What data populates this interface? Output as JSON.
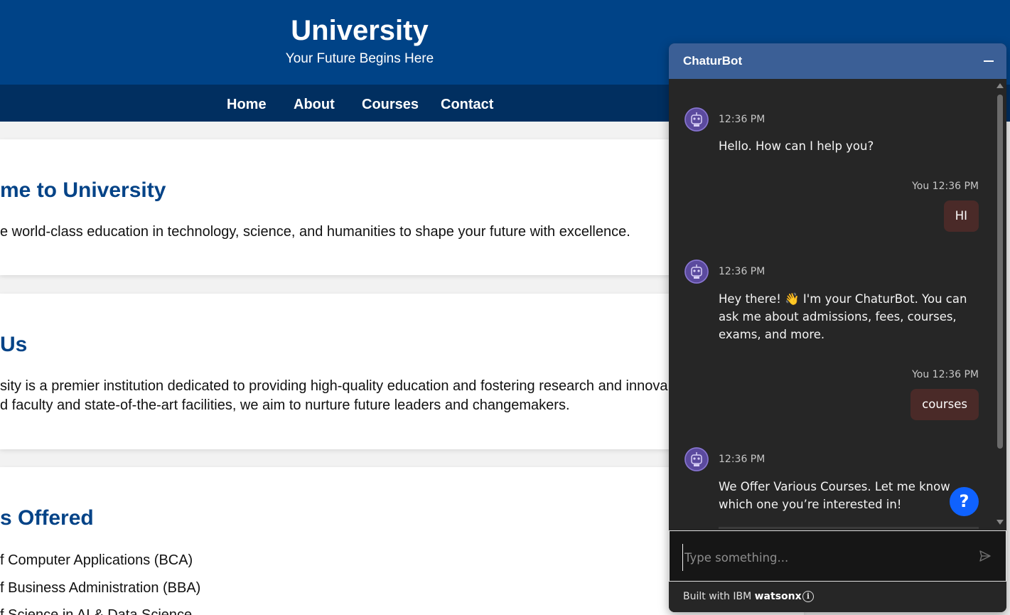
{
  "site": {
    "title": "University",
    "tagline": "Your Future Begins Here"
  },
  "nav": {
    "items": [
      "Home",
      "About",
      "Courses",
      "Contact"
    ]
  },
  "welcome": {
    "heading": "me to University",
    "text": "e world-class education in technology, science, and humanities to shape your future with excellence."
  },
  "about": {
    "heading": "Us",
    "line1": "sity is a premier institution dedicated to providing high-quality education and fostering research and innova",
    "line2": "d faculty and state-of-the-art facilities, we aim to nurture future leaders and changemakers."
  },
  "courses": {
    "heading": "s Offered",
    "items": [
      "f Computer Applications (BCA)",
      "f Business Administration (BBA)",
      "f Science in AI & Data Science"
    ]
  },
  "chat": {
    "title": "ChaturBot",
    "messages": [
      {
        "from": "bot",
        "time": "12:36 PM",
        "text": "Hello. How can I help you?"
      },
      {
        "from": "user",
        "meta": "You 12:36 PM",
        "text": "HI"
      },
      {
        "from": "bot",
        "time": "12:36 PM",
        "text": "Hey there! 👋 I'm your ChaturBot. You can ask me about admissions, fees, courses, exams, and more."
      },
      {
        "from": "user",
        "meta": "You 12:36 PM",
        "text": "courses"
      },
      {
        "from": "bot",
        "time": "12:36 PM",
        "text": "We Offer Various Courses. Let me know which one you’re interested in!"
      }
    ],
    "input_placeholder": "Type something...",
    "help_label": "?",
    "footer_prefix": "Built with IBM ",
    "footer_brand": "watsonx",
    "colors": {
      "header": "#3b5f96",
      "panel": "#262626",
      "user_bubble": "#4a2a28",
      "help_button": "#0f62fe"
    }
  },
  "icons": {
    "minimize": "minimize-icon",
    "send": "send-icon",
    "info": "info-icon",
    "avatar": "robot-icon"
  },
  "colors": {
    "header": "#004387",
    "nav": "#012f60",
    "heading": "#044387"
  }
}
